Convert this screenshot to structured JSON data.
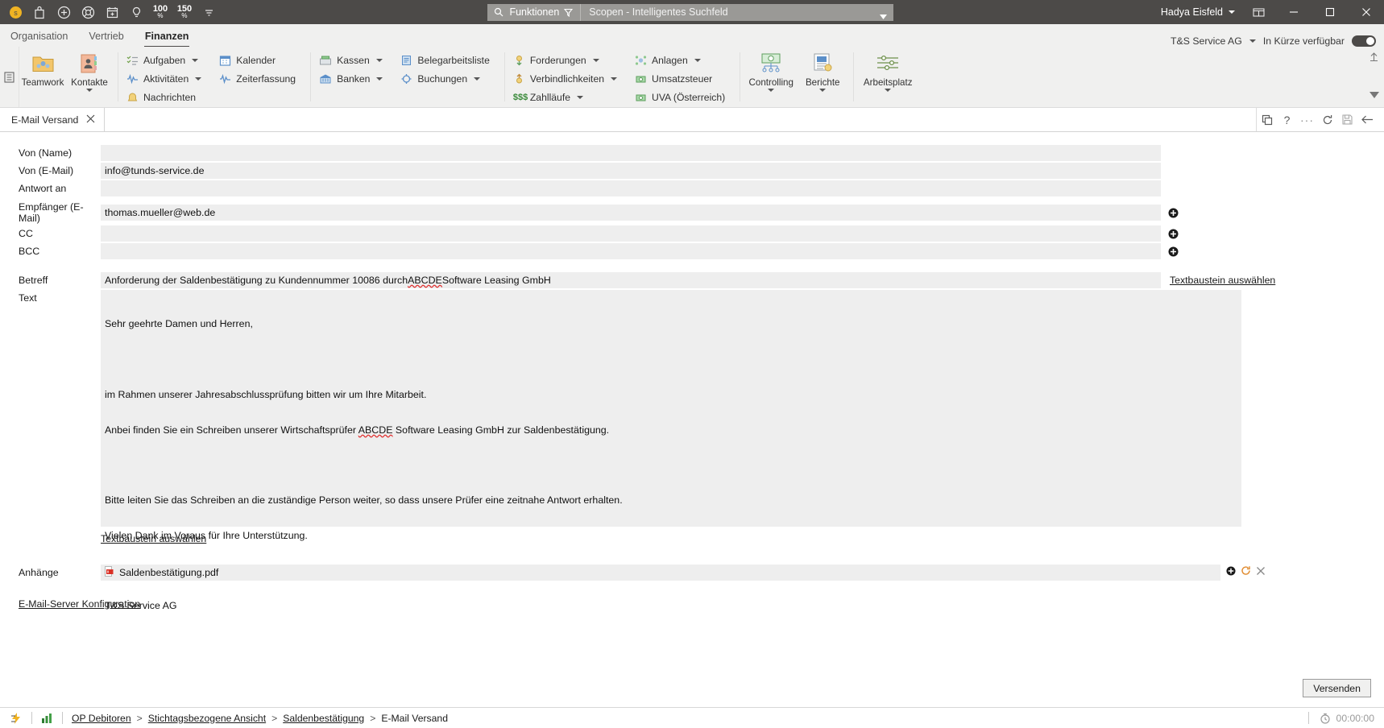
{
  "titlebar": {
    "quick_access": [
      {
        "name": "scopevisio-logo-icon",
        "label": "Scopevisio"
      },
      {
        "name": "shopping-bag-icon",
        "label": "Shop"
      },
      {
        "name": "plus-circle-icon",
        "label": "Neu"
      },
      {
        "name": "lifebuoy-icon",
        "label": "Hilfe"
      },
      {
        "name": "calendar-add-icon",
        "label": "Termin"
      },
      {
        "name": "lightbulb-icon",
        "label": "Idee"
      },
      {
        "name": "zoom-100-icon",
        "label": "100",
        "unit": "%"
      },
      {
        "name": "zoom-150-icon",
        "label": "150",
        "unit": "%"
      },
      {
        "name": "more-options-icon",
        "label": "Mehr"
      }
    ],
    "search": {
      "functions_label": "Funktionen",
      "placeholder": "Scopen - Intelligentes Suchfeld",
      "value": ""
    },
    "user_name": "Hadya Eisfeld",
    "window_controls": {
      "restore_layout": "Fensterlayout",
      "minimize": "Minimieren",
      "maximize": "Maximieren",
      "close": "Schließen"
    }
  },
  "ribbon_tabs": {
    "items": [
      {
        "label": "Organisation",
        "active": false
      },
      {
        "label": "Vertrieb",
        "active": false
      },
      {
        "label": "Finanzen",
        "active": true
      }
    ],
    "company": "T&S Service AG",
    "availability_label": "In Kürze verfügbar",
    "availability_on": true
  },
  "ribbon": {
    "big_items": [
      {
        "label": "Teamwork",
        "icon": "teamwork-folder-icon",
        "caret": false
      },
      {
        "label": "Kontakte",
        "icon": "contacts-book-icon",
        "caret": true
      }
    ],
    "group1": [
      {
        "label": "Aufgaben",
        "icon": "tasks-list-icon",
        "caret": true
      },
      {
        "label": "Aktivitäten",
        "icon": "activities-pulse-icon",
        "caret": true
      },
      {
        "label": "Nachrichten",
        "icon": "messages-bell-icon",
        "caret": false
      }
    ],
    "group2": [
      {
        "label": "Kalender",
        "icon": "calendar-icon",
        "caret": false
      },
      {
        "label": "Zeiterfassung",
        "icon": "time-tracking-icon",
        "caret": false
      }
    ],
    "group3": [
      {
        "label": "Kassen",
        "icon": "cash-register-icon",
        "caret": true
      },
      {
        "label": "Banken",
        "icon": "bank-icon",
        "caret": true
      }
    ],
    "group4": [
      {
        "label": "Belegarbeitsliste",
        "icon": "document-list-icon",
        "caret": false
      },
      {
        "label": "Buchungen",
        "icon": "bookings-icon",
        "caret": true
      }
    ],
    "group5": [
      {
        "label": "Forderungen",
        "icon": "receivables-icon",
        "caret": true
      },
      {
        "label": "Verbindlichkeiten",
        "icon": "payables-icon",
        "caret": true
      },
      {
        "label": "Zahlläufe",
        "icon": "payment-runs-icon",
        "caret": true
      }
    ],
    "group6": [
      {
        "label": "Anlagen",
        "icon": "assets-icon",
        "caret": true
      },
      {
        "label": "Umsatzsteuer",
        "icon": "vat-icon",
        "caret": false
      },
      {
        "label": "UVA (Österreich)",
        "icon": "uva-austria-icon",
        "caret": false
      }
    ],
    "big_items2": [
      {
        "label": "Controlling",
        "icon": "controlling-icon",
        "caret": true
      },
      {
        "label": "Berichte",
        "icon": "reports-icon",
        "caret": true
      },
      {
        "label": "Arbeitsplatz",
        "icon": "workplace-icon",
        "caret": true
      }
    ]
  },
  "doctabs": {
    "tabs": [
      {
        "label": "E-Mail Versand",
        "active": true,
        "closable": true
      }
    ],
    "actions": [
      {
        "name": "duplicate-window-icon",
        "label": "Duplizieren"
      },
      {
        "name": "help-icon",
        "label": "Hilfe"
      },
      {
        "name": "more-icon",
        "label": "Mehr"
      },
      {
        "name": "refresh-icon",
        "label": "Aktualisieren"
      },
      {
        "name": "save-icon",
        "label": "Speichern"
      },
      {
        "name": "back-arrow-icon",
        "label": "Zurück"
      }
    ]
  },
  "form": {
    "fields": [
      {
        "label": "Von (Name)",
        "value": "",
        "key": "from_name"
      },
      {
        "label": "Von (E-Mail)",
        "value": "info@tunds-service.de",
        "key": "from_email"
      },
      {
        "label": "Antwort an",
        "value": "",
        "key": "reply_to"
      }
    ],
    "recipients": [
      {
        "label": "Empfänger (E-Mail)",
        "value": "thomas.mueller@web.de",
        "key": "to"
      },
      {
        "label": "CC",
        "value": "",
        "key": "cc"
      },
      {
        "label": "BCC",
        "value": "",
        "key": "bcc"
      }
    ],
    "subject": {
      "label": "Betreff",
      "value_pre": "Anforderung der Saldenbestätigung zu Kundennummer 10086 durch ",
      "value_mark": "ABCDE",
      "value_post": " Software Leasing GmbH",
      "full_value": "Anforderung der Saldenbestätigung zu Kundennummer 10086 durch ABCDE Software Leasing GmbH",
      "snippet_link": "Textbaustein auswählen"
    },
    "body": {
      "label": "Text",
      "line1": "Sehr geehrte Damen und Herren,",
      "line2": "",
      "line3": "im Rahmen unserer Jahresabschlussprüfung bitten wir um Ihre Mitarbeit.",
      "line4_pre": "Anbei finden Sie ein Schreiben unserer Wirtschaftsprüfer ",
      "line4_mark": "ABCDE",
      "line4_post": " Software Leasing GmbH zur Saldenbestätigung.",
      "line5": "",
      "line6": "Bitte leiten Sie das Schreiben an die zuständige Person weiter, so dass unsere Prüfer eine zeitnahe Antwort erhalten.",
      "line7": "Vielen Dank im Voraus für Ihre Unterstützung.",
      "line8": "",
      "line9": "T&S Service AG",
      "snippet_link": "Textbaustein auswählen"
    },
    "attachments": {
      "label": "Anhänge",
      "file_name": "Saldenbestätigung.pdf",
      "file_icon": "pdf-file-icon",
      "actions": [
        {
          "name": "add-attachment-icon",
          "label": "Hinzufügen"
        },
        {
          "name": "reload-attachment-icon",
          "label": "Neu laden"
        },
        {
          "name": "remove-attachment-icon",
          "label": "Entfernen"
        }
      ]
    },
    "server_config_link": "E-Mail-Server Konfiguration",
    "send_button": "Versenden"
  },
  "statusbar": {
    "icons": [
      {
        "name": "lightning-icon",
        "label": "Aktionen"
      },
      {
        "name": "chart-bars-icon",
        "label": "Statistik"
      }
    ],
    "breadcrumb": [
      {
        "label": "OP Debitoren",
        "link": true
      },
      {
        "label": "Stichtagsbezogene Ansicht",
        "link": true
      },
      {
        "label": "Saldenbestätigung",
        "link": true
      },
      {
        "label": "E-Mail Versand",
        "link": false
      }
    ],
    "separator": ">",
    "timer_icon": "stopwatch-icon",
    "timer": "00:00:00"
  },
  "colors": {
    "titlebar_bg": "#4c4a48",
    "ribbon_bg": "#f0f0ef",
    "field_bg": "#eeeeee",
    "accent_yellow": "#f0b323",
    "green": "#3a8a3a"
  }
}
